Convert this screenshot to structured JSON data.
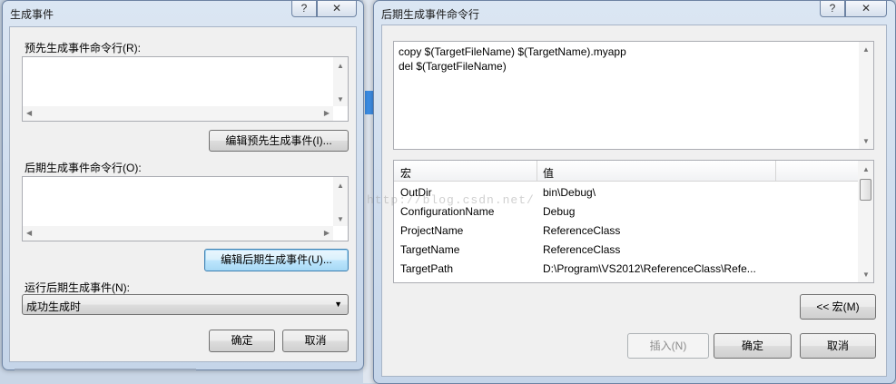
{
  "left_dialog": {
    "title": "生成事件",
    "help_btn": "?",
    "close_btn": "✕",
    "prebuild_label": "预先生成事件命令行(R):",
    "prebuild_value": "",
    "edit_prebuild_btn": "编辑预先生成事件(I)...",
    "postbuild_label": "后期生成事件命令行(O):",
    "postbuild_value": "",
    "edit_postbuild_btn": "编辑后期生成事件(U)...",
    "run_label": "运行后期生成事件(N):",
    "run_value": "成功生成时",
    "ok_btn": "确定",
    "cancel_btn": "取消"
  },
  "right_dialog": {
    "title": "后期生成事件命令行",
    "help_btn": "?",
    "close_btn": "✕",
    "command_lines": [
      "copy $(TargetFileName) $(TargetName).myapp",
      "del $(TargetFileName)"
    ],
    "macro_table": {
      "headers": [
        "宏",
        "值"
      ],
      "rows": [
        {
          "macro": "OutDir",
          "value": "bin\\Debug\\"
        },
        {
          "macro": "ConfigurationName",
          "value": "Debug"
        },
        {
          "macro": "ProjectName",
          "value": "ReferenceClass"
        },
        {
          "macro": "TargetName",
          "value": "ReferenceClass"
        },
        {
          "macro": "TargetPath",
          "value": "D:\\Program\\VS2012\\ReferenceClass\\Refe..."
        }
      ]
    },
    "macro_btn": "<< 宏(M)",
    "insert_btn": "插入(N)",
    "ok_btn": "确定",
    "cancel_btn": "取消"
  },
  "watermark": "http://blog.csdn.net/"
}
